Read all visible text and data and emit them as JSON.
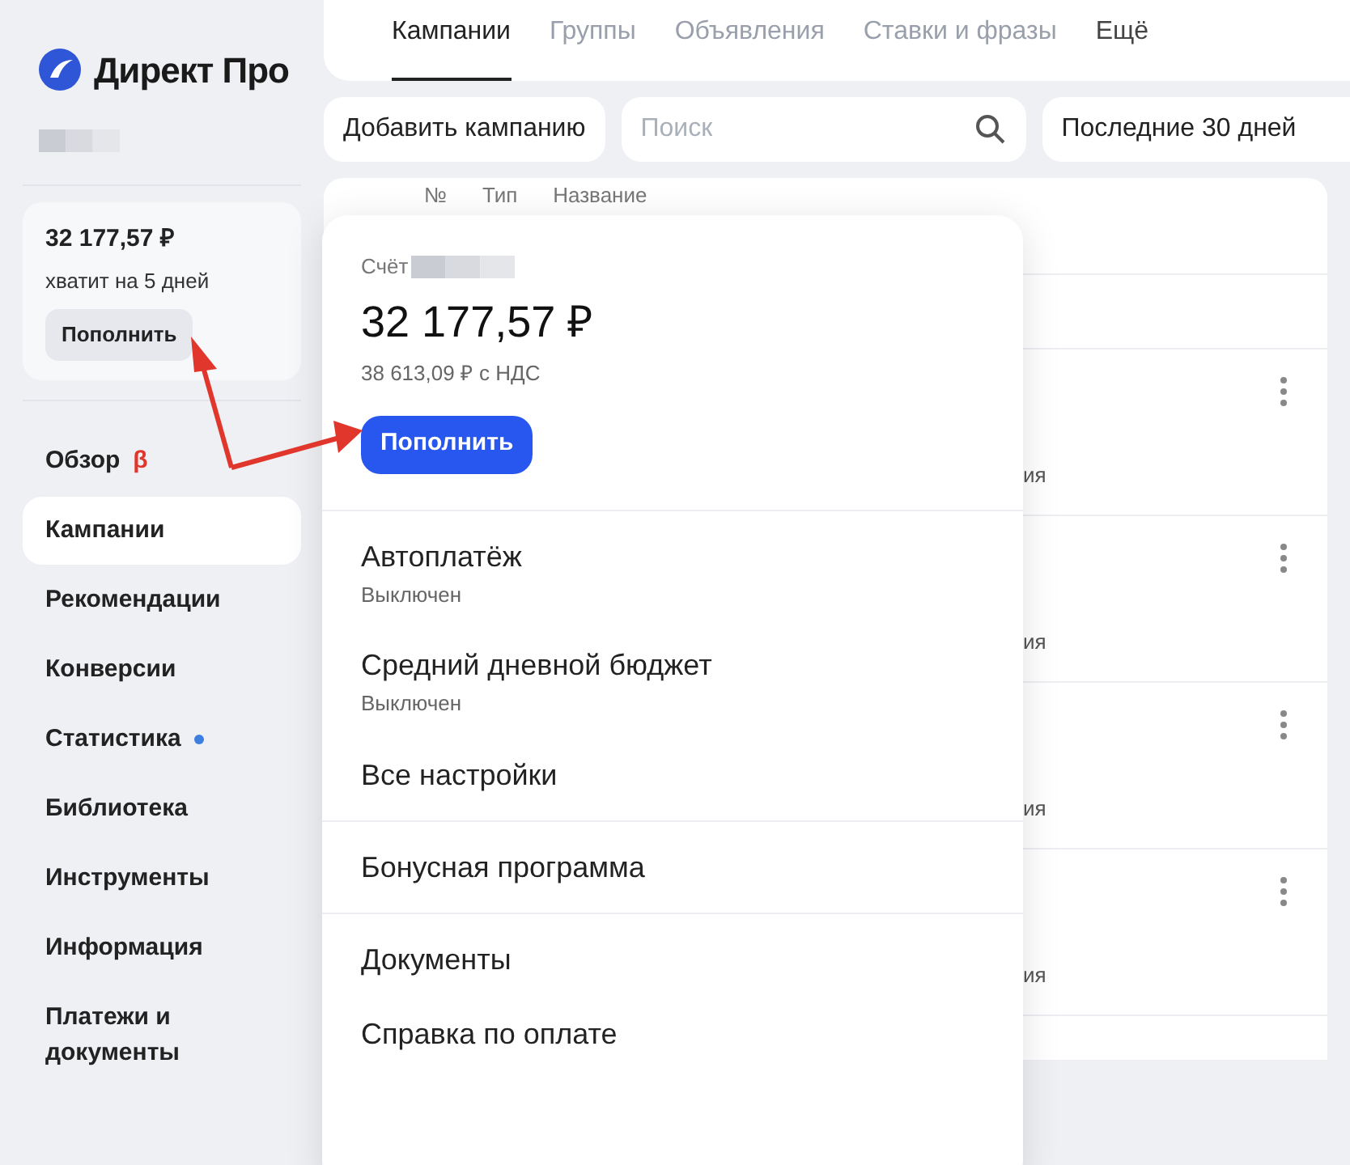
{
  "logo": {
    "text": "Директ Про"
  },
  "balance_card": {
    "amount": "32 177,57 ₽",
    "forecast": "хватит на 5 дней",
    "button": "Пополнить"
  },
  "sidebar": {
    "items": [
      {
        "label": "Обзор",
        "selected": false,
        "badge": "β",
        "dot": false
      },
      {
        "label": "Кампании",
        "selected": true,
        "dot": false
      },
      {
        "label": "Рекомендации",
        "selected": false,
        "dot": false
      },
      {
        "label": "Конверсии",
        "selected": false,
        "dot": false
      },
      {
        "label": "Статистика",
        "selected": false,
        "dot": true
      },
      {
        "label": "Библиотека",
        "selected": false,
        "dot": false
      },
      {
        "label": "Инструменты",
        "selected": false,
        "dot": false
      },
      {
        "label": "Информация",
        "selected": false,
        "dot": false
      },
      {
        "label": "Платежи и документы",
        "selected": false,
        "dot": false
      }
    ]
  },
  "tabs": [
    {
      "label": "Кампании",
      "kind": "tab",
      "selected": true
    },
    {
      "label": "Группы",
      "kind": "tab",
      "selected": false
    },
    {
      "label": "Объявления",
      "kind": "tab",
      "selected": false
    },
    {
      "label": "Ставки и фразы",
      "kind": "tab",
      "selected": false
    },
    {
      "label": "Ещё",
      "kind": "more",
      "selected": false
    }
  ],
  "toolbar": {
    "add_button": "Добавить кампанию",
    "search": {
      "placeholder": "Поиск"
    },
    "period": "Последние 30 дней"
  },
  "table": {
    "columns": [
      "№",
      "Тип",
      "Название"
    ],
    "rows": [
      {
        "column_3": "ия"
      },
      {
        "column_3": "ия"
      },
      {
        "column_3": "ия"
      },
      {
        "column_3": "ия"
      }
    ]
  },
  "popup": {
    "account_label": "Счёт",
    "amount": "32 177,57 ₽",
    "amount_with_vat": "38 613,09 ₽ с НДС",
    "button": "Пополнить",
    "sections": [
      {
        "items": [
          {
            "label": "Автоплатёж",
            "status": "Выключен"
          },
          {
            "label": "Средний дневной бюджет",
            "status": "Выключен"
          },
          {
            "label": "Все настройки"
          }
        ]
      },
      {
        "items": [
          {
            "label": "Бонусная программа"
          }
        ]
      },
      {
        "items": [
          {
            "label": "Документы"
          },
          {
            "label": "Справка по оплате"
          }
        ]
      }
    ]
  }
}
